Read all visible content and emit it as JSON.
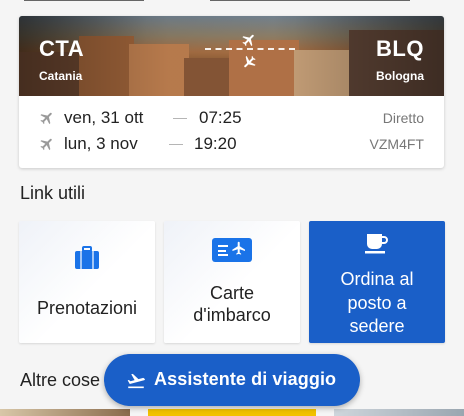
{
  "trip": {
    "origin_code": "CTA",
    "origin_city": "Catania",
    "dest_code": "BLQ",
    "dest_city": "Bologna",
    "outbound": {
      "date": "ven, 31 ott",
      "time": "07:25",
      "note": "Diretto"
    },
    "return": {
      "date": "lun, 3 nov",
      "time": "19:20",
      "note": "VZM4FT"
    }
  },
  "useful_links": {
    "title": "Link utili",
    "tiles": [
      {
        "label": "Prenotazioni",
        "icon": "suitcase-icon"
      },
      {
        "label_line1": "Carte",
        "label_line2": "d'imbarco",
        "icon": "boarding-pass-icon"
      },
      {
        "label_line1": "Ordina al",
        "label_line2": "posto a",
        "label_line3": "sedere",
        "icon": "coffee-cup-icon"
      }
    ]
  },
  "other_section": {
    "title": "Altre cose"
  },
  "assistant_button": {
    "label": "Assistente di viaggio",
    "icon": "plane-departure-icon"
  },
  "colors": {
    "primary": "#1a5fc8",
    "icon_blue": "#1a73e8"
  }
}
